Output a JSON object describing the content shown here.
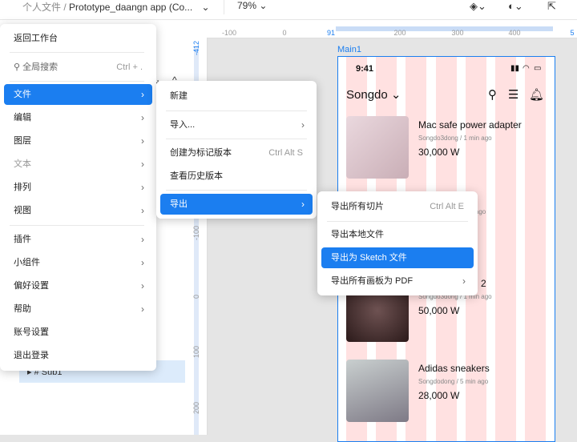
{
  "topbar": {
    "breadcrumb_team": "个人文件",
    "breadcrumb_sep": "/",
    "project_name": "Prototype_daangn app (Co...",
    "zoom": "79%"
  },
  "left_panel": {
    "layer_sub": "Sub1"
  },
  "ruler_top": [
    "-100",
    "0",
    "91",
    "200",
    "300",
    "400",
    "5"
  ],
  "ruler_left": [
    "-412",
    "-100",
    "0",
    "100",
    "200"
  ],
  "canvas": {
    "frame_label": "Main1",
    "phone": {
      "time": "9:41",
      "title": "Songdo",
      "items": [
        {
          "title": "Mac safe power adapter",
          "sub": "Songdo3dong / 1 min ago",
          "price": "30,000 W"
        },
        {
          "title": "",
          "sub": "nin ago",
          "price": ""
        },
        {
          "title": "2",
          "sub": "Songdo3dong / 1 min ago",
          "price": "50,000 W"
        },
        {
          "title": "Adidas sneakers",
          "sub": "Songdodong / 5 min ago",
          "price": "28,000 W"
        }
      ]
    }
  },
  "main_menu": {
    "back": "返回工作台",
    "search": "全局搜索",
    "search_shortcut": "Ctrl + .",
    "items": {
      "file": "文件",
      "edit": "编辑",
      "layer": "图层",
      "text": "文本",
      "arrange": "排列",
      "view": "视图",
      "plugins": "插件",
      "widgets": "小组件",
      "preferences": "偏好设置",
      "help": "帮助",
      "account": "账号设置",
      "logout": "退出登录"
    }
  },
  "file_menu": {
    "new": "新建",
    "import": "导入...",
    "create_version": "创建为标记版本",
    "create_version_shortcut": "Ctrl Alt S",
    "history": "查看历史版本",
    "export": "导出"
  },
  "export_menu": {
    "all_slices": "导出所有切片",
    "all_slices_shortcut": "Ctrl Alt E",
    "local_file": "导出本地文件",
    "sketch": "导出为 Sketch 文件",
    "pdf": "导出所有画板为 PDF"
  },
  "colors": {
    "accent": "#1b7ef0",
    "layout_column": "#ffaaaa"
  }
}
